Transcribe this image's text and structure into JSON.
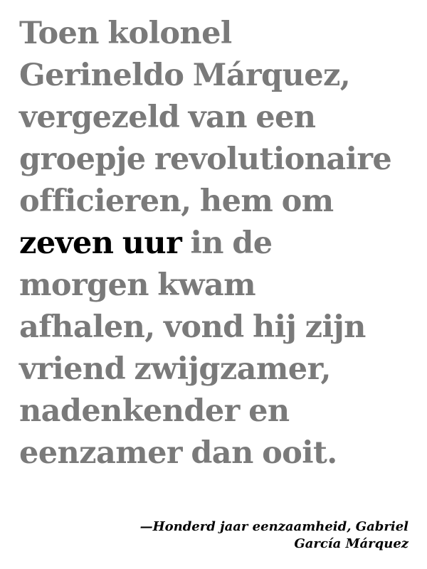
{
  "quote": {
    "lines": [
      {
        "before": "Toen kolonel"
      },
      {
        "before": "Gerineldo Márquez,"
      },
      {
        "before": "vergezeld van een"
      },
      {
        "before": "groepje revolutionaire"
      },
      {
        "before": "officieren, hem om"
      },
      {
        "before": "",
        "highlight": "zeven uur",
        "after": " in de"
      },
      {
        "before": "morgen kwam"
      },
      {
        "before": "afhalen, vond hij zijn"
      },
      {
        "before": "vriend zwijgzamer,"
      },
      {
        "before": "nadenkender en"
      },
      {
        "before": "eenzamer dan ooit."
      }
    ]
  },
  "attribution": {
    "line1": "—Honderd jaar eenzaamheid, Gabriel",
    "line2": "García Márquez"
  },
  "colors": {
    "text_muted": "#7a7a7a",
    "text_highlight": "#000000",
    "background": "#ffffff"
  }
}
